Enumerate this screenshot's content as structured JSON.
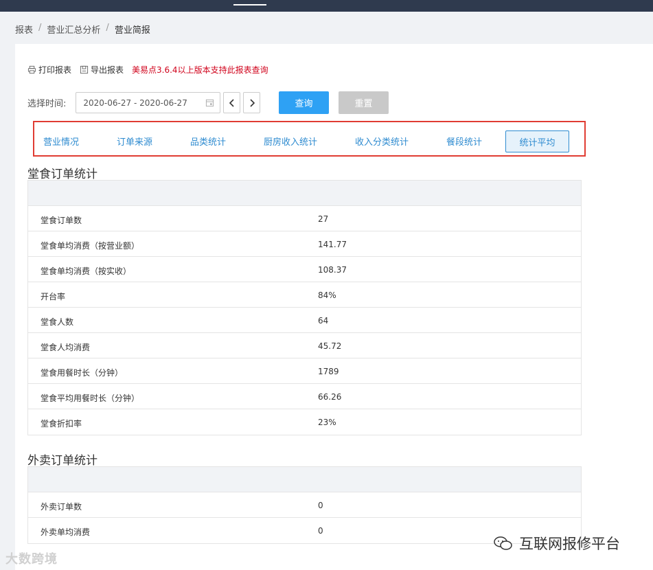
{
  "breadcrumb": [
    "报表",
    "营业汇总分析",
    "营业简报"
  ],
  "actions": {
    "print_label": "打印报表",
    "export_label": "导出报表",
    "notice": "美易点3.6.4以上版本支持此报表查询"
  },
  "filter": {
    "time_label": "选择时间:",
    "date_range": "2020-06-27 - 2020-06-27",
    "query_button": "查询",
    "reset_button": "重置"
  },
  "tabs": [
    {
      "label": "营业情况"
    },
    {
      "label": "订单来源"
    },
    {
      "label": "品类统计"
    },
    {
      "label": "厨房收入统计"
    },
    {
      "label": "收入分类统计"
    },
    {
      "label": "餐段统计"
    },
    {
      "label": "统计平均",
      "active": true
    }
  ],
  "dine_in": {
    "title": "堂食订单统计",
    "rows": [
      {
        "label": "堂食订单数",
        "value": "27"
      },
      {
        "label": "堂食单均消费（按营业额）",
        "value": "141.77"
      },
      {
        "label": "堂食单均消费（按实收）",
        "value": "108.37"
      },
      {
        "label": "开台率",
        "value": "84%"
      },
      {
        "label": "堂食人数",
        "value": "64"
      },
      {
        "label": "堂食人均消费",
        "value": "45.72"
      },
      {
        "label": "堂食用餐时长（分钟）",
        "value": "1789"
      },
      {
        "label": "堂食平均用餐时长（分钟）",
        "value": "66.26"
      },
      {
        "label": "堂食折扣率",
        "value": "23%"
      }
    ]
  },
  "takeout": {
    "title": "外卖订单统计",
    "rows": [
      {
        "label": "外卖订单数",
        "value": "0"
      },
      {
        "label": "外卖单均消费",
        "value": "0"
      }
    ]
  },
  "watermarks": {
    "left": "大数跨境",
    "right": "互联网报修平台"
  },
  "colors": {
    "topbar": "#2f3a4e",
    "primary": "#2ea1f4",
    "tab_text": "#2e8bd0",
    "highlight_border": "#e03c32",
    "notice": "#d0021b"
  }
}
